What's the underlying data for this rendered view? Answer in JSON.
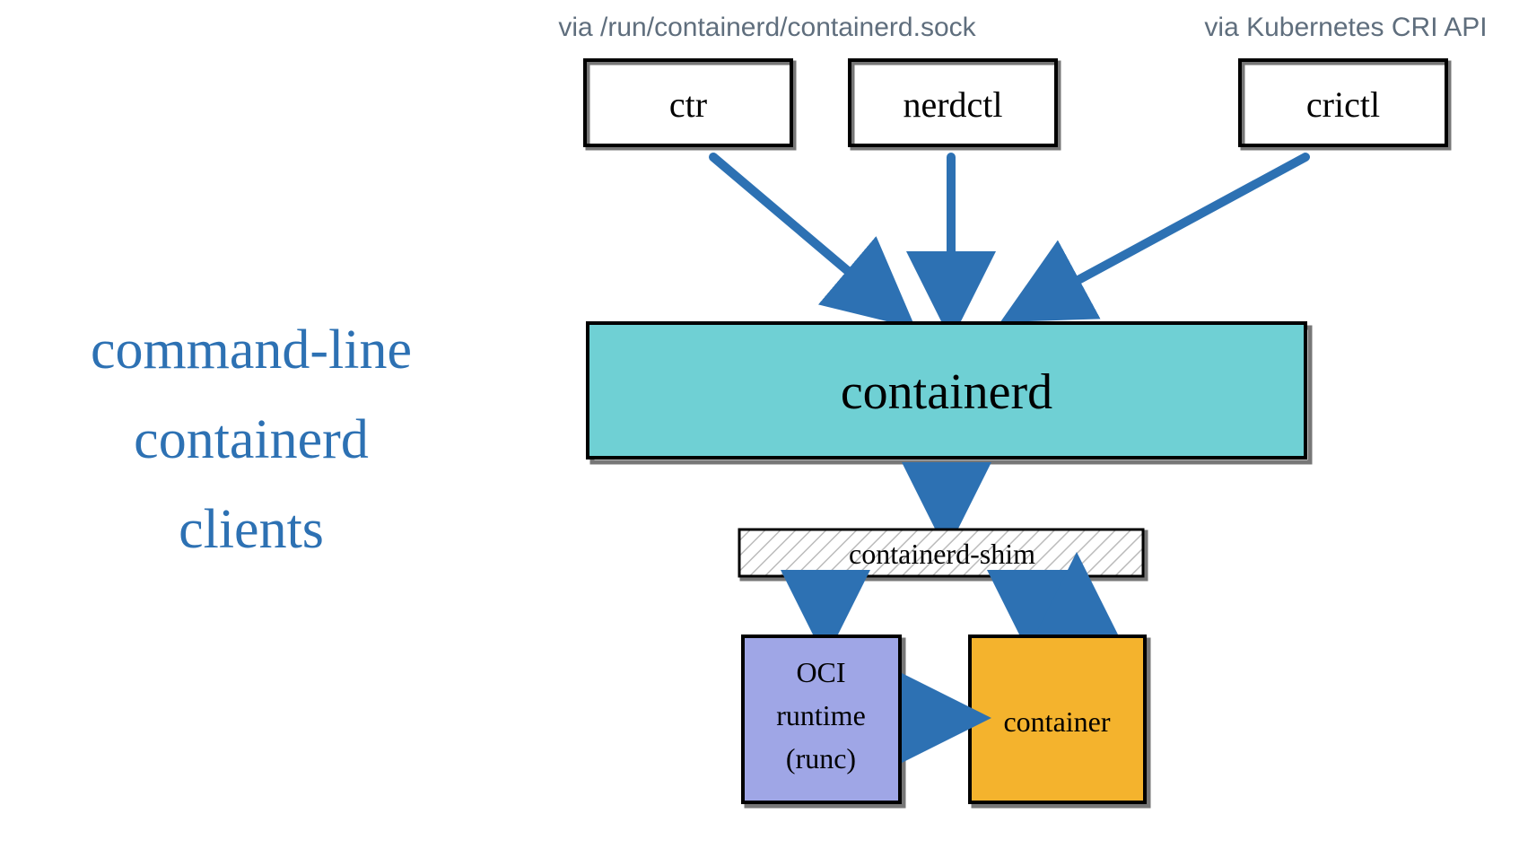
{
  "title": {
    "line1": "command-line",
    "line2": "containerd",
    "line3": "clients"
  },
  "captions": {
    "sock": "via /run/containerd/containerd.sock",
    "cri": "via Kubernetes CRI API"
  },
  "boxes": {
    "ctr": "ctr",
    "nerdctl": "nerdctl",
    "crictl": "crictl",
    "containerd": "containerd",
    "shim": "containerd-shim",
    "oci_l1": "OCI",
    "oci_l2": "runtime",
    "oci_l3": "(runc)",
    "container": "container"
  },
  "colors": {
    "containerd_fill": "#6fd0d4",
    "oci_fill": "#9fa6e6",
    "container_fill": "#f4b32d",
    "arrow": "#2d71b3",
    "title": "#2d71b3"
  }
}
